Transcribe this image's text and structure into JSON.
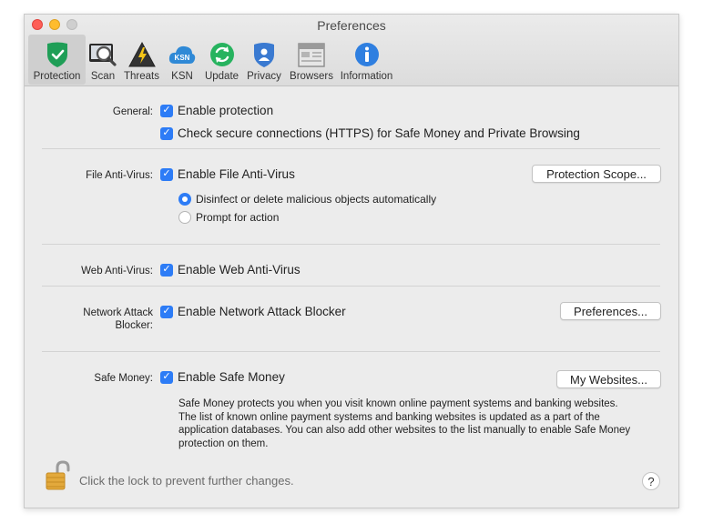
{
  "window": {
    "title": "Preferences",
    "tabs": [
      {
        "label": "Protection",
        "icon": "shield-check-icon",
        "active": true
      },
      {
        "label": "Scan",
        "icon": "magnifier-scan-icon"
      },
      {
        "label": "Threats",
        "icon": "warning-triangle-icon"
      },
      {
        "label": "KSN",
        "icon": "cloud-ksn-icon"
      },
      {
        "label": "Update",
        "icon": "refresh-icon"
      },
      {
        "label": "Privacy",
        "icon": "privacy-shield-icon"
      },
      {
        "label": "Browsers",
        "icon": "browser-window-icon"
      },
      {
        "label": "Information",
        "icon": "info-icon"
      }
    ]
  },
  "general": {
    "label": "General:",
    "enable_protection": "Enable protection",
    "check_https": "Check secure connections (HTTPS) for Safe Money and Private Browsing"
  },
  "file_av": {
    "label": "File Anti-Virus:",
    "enable": "Enable File Anti-Virus",
    "scope_button": "Protection Scope...",
    "option_auto": "Disinfect or delete malicious objects automatically",
    "option_prompt": "Prompt for action",
    "selected": "option_auto"
  },
  "web_av": {
    "label": "Web Anti-Virus:",
    "enable": "Enable Web Anti-Virus"
  },
  "network": {
    "label_line1": "Network Attack",
    "label_line2": "Blocker:",
    "enable": "Enable Network Attack Blocker",
    "prefs_button": "Preferences..."
  },
  "safe_money": {
    "label": "Safe Money:",
    "enable": "Enable Safe Money",
    "websites_button": "My Websites...",
    "description_lines": [
      "Safe Money protects you when you visit known online payment systems and banking websites.",
      "The list of known online payment systems and banking websites is updated as a part of the",
      "application databases. You can also add other websites to the list manually to enable Safe Money",
      "protection on them."
    ]
  },
  "footer": {
    "lock_text": "Click the lock to prevent further changes.",
    "help": "?"
  },
  "colors": {
    "accent": "#2d7cf6",
    "protection_green": "#1f9e57",
    "update_green": "#27b35f",
    "ksn_blue": "#2f89d6",
    "privacy_blue": "#3a7ad1",
    "info_blue": "#2f7fe0"
  }
}
